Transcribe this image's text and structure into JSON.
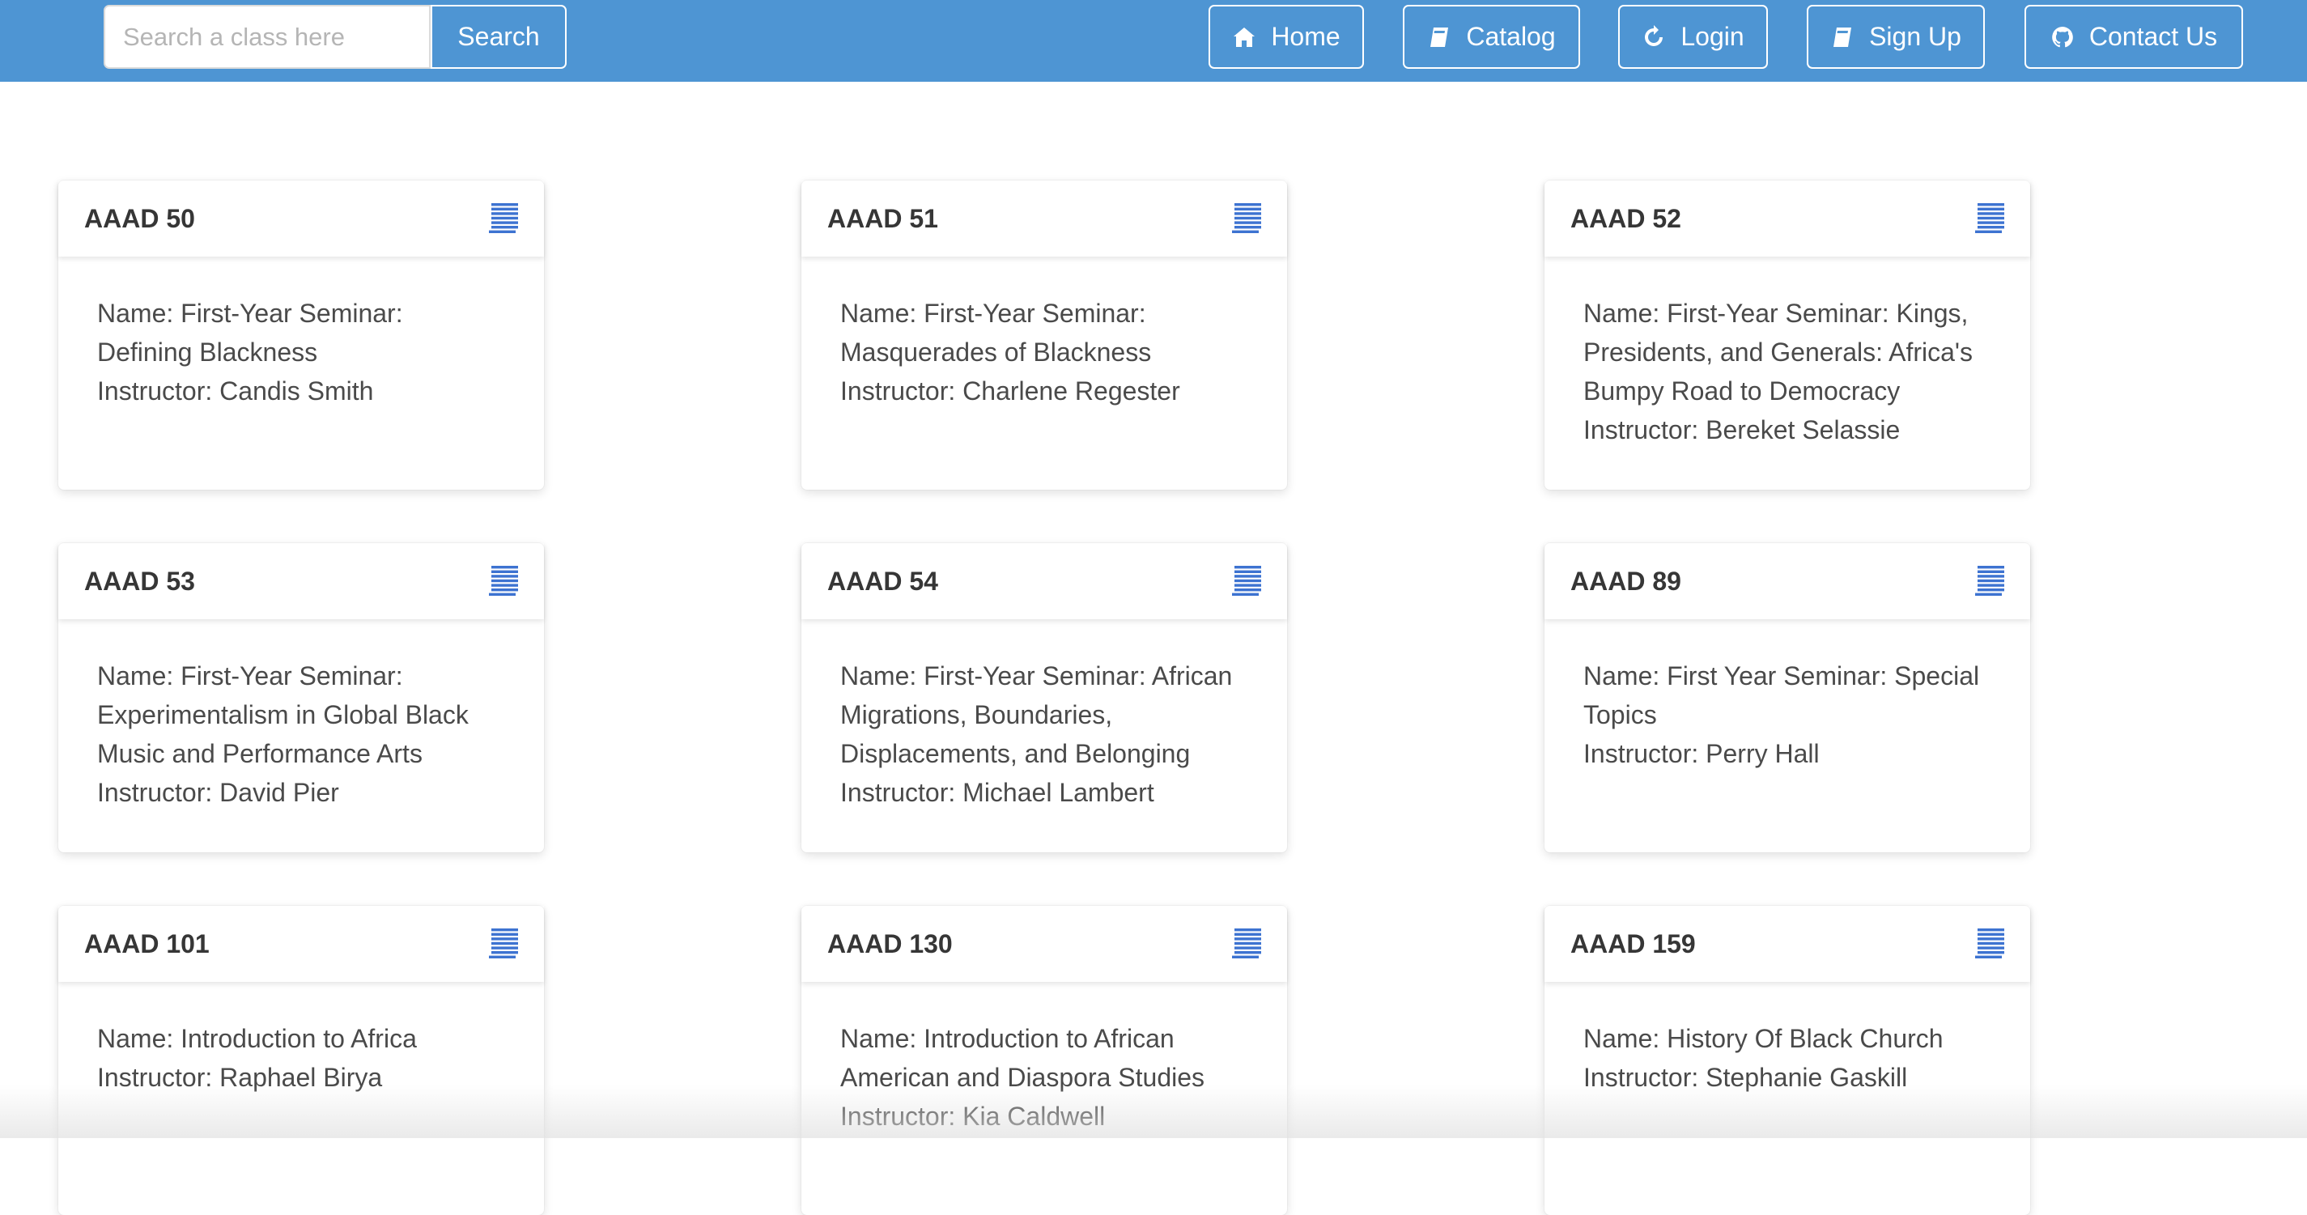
{
  "navbar": {
    "search": {
      "placeholder": "Search a class here",
      "value": "",
      "button_label": "Search"
    },
    "links": [
      {
        "label": "Home",
        "icon": "home-icon"
      },
      {
        "label": "Catalog",
        "icon": "book-icon"
      },
      {
        "label": "Login",
        "icon": "refresh-icon"
      },
      {
        "label": "Sign Up",
        "icon": "book-icon"
      },
      {
        "label": "Contact Us",
        "icon": "github-icon"
      }
    ]
  },
  "colors": {
    "navbar": "#4e95d3",
    "icon_accent": "#3d73d1"
  },
  "courses": [
    {
      "code": "AAAD 50",
      "name_line1": "Name: First-Year Seminar:",
      "name_line2": "Defining Blackness",
      "name_line3": "",
      "instructor": "Instructor: Candis Smith",
      "icon": "list-icon"
    },
    {
      "code": "AAAD 51",
      "name_line1": "Name: First-Year Seminar:",
      "name_line2": "Masquerades of Blackness",
      "name_line3": "",
      "instructor": "Instructor: Charlene Regester",
      "icon": "list-icon"
    },
    {
      "code": "AAAD 52",
      "name_line1": "Name: First-Year Seminar: Kings,",
      "name_line2": "Presidents, and Generals: Africa's",
      "name_line3": "Bumpy Road to Democracy",
      "instructor": "Instructor: Bereket Selassie",
      "icon": "list-icon"
    },
    {
      "code": "AAAD 53",
      "name_line1": "Name: First-Year Seminar:",
      "name_line2": "Experimentalism in Global Black",
      "name_line3": "Music and Performance Arts",
      "instructor": "Instructor: David Pier",
      "icon": "list-icon"
    },
    {
      "code": "AAAD 54",
      "name_line1": "Name: First-Year Seminar: African",
      "name_line2": "Migrations, Boundaries,",
      "name_line3": "Displacements, and Belonging",
      "instructor": "Instructor: Michael Lambert",
      "icon": "list-icon"
    },
    {
      "code": "AAAD 89",
      "name_line1": "Name: First Year Seminar: Special",
      "name_line2": "Topics",
      "name_line3": "",
      "instructor": "Instructor: Perry Hall",
      "icon": "list-icon"
    },
    {
      "code": "AAAD 101",
      "name_line1": "Name: Introduction to Africa",
      "name_line2": "",
      "name_line3": "",
      "instructor": "Instructor: Raphael Birya",
      "icon": "list-icon"
    },
    {
      "code": "AAAD 130",
      "name_line1": "Name: Introduction to African",
      "name_line2": "American and Diaspora Studies",
      "name_line3": "",
      "instructor": "Instructor: Kia Caldwell",
      "icon": "list-icon"
    },
    {
      "code": "AAAD 159",
      "name_line1": "Name: History Of Black Church",
      "name_line2": "",
      "name_line3": "",
      "instructor": "Instructor: Stephanie Gaskill",
      "icon": "list-icon"
    }
  ]
}
